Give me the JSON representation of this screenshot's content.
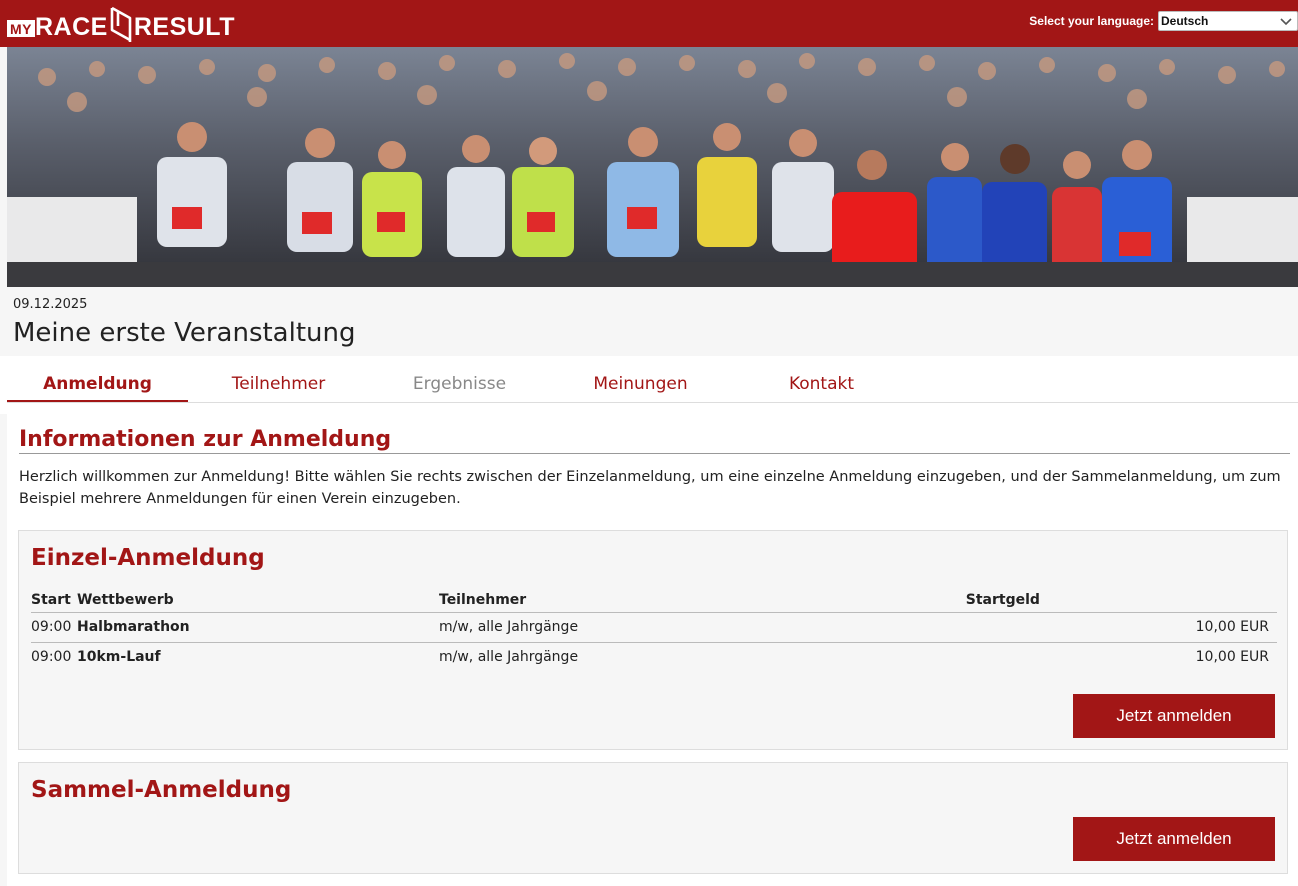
{
  "header": {
    "logo_my": "MY",
    "logo_race": "RACE",
    "logo_result": "RESULT",
    "language_label": "Select your language:",
    "language_selected": "Deutsch"
  },
  "event": {
    "date": "09.12.2025",
    "title": "Meine erste Veranstaltung"
  },
  "tabs": [
    {
      "label": "Anmeldung",
      "state": "active"
    },
    {
      "label": "Teilnehmer",
      "state": "normal"
    },
    {
      "label": "Ergebnisse",
      "state": "disabled"
    },
    {
      "label": "Meinungen",
      "state": "normal"
    },
    {
      "label": "Kontakt",
      "state": "normal"
    }
  ],
  "info": {
    "title": "Informationen zur Anmeldung",
    "text": "Herzlich willkommen zur Anmeldung! Bitte wählen Sie rechts zwischen der Einzelanmeldung, um eine einzelne Anmeldung einzugeben, und der Sammelanmeldung, um zum Beispiel mehrere Anmeldungen für einen Verein einzugeben."
  },
  "einzel": {
    "title": "Einzel-Anmeldung",
    "columns": {
      "start": "Start",
      "competition": "Wettbewerb",
      "participants": "Teilnehmer",
      "fee": "Startgeld"
    },
    "rows": [
      {
        "start": "09:00",
        "competition": "Halbmarathon",
        "participants": "m/w, alle Jahrgänge",
        "fee": "10,00 EUR"
      },
      {
        "start": "09:00",
        "competition": "10km-Lauf",
        "participants": "m/w, alle Jahrgänge",
        "fee": "10,00 EUR"
      }
    ],
    "button": "Jetzt anmelden"
  },
  "sammel": {
    "title": "Sammel-Anmeldung",
    "button": "Jetzt anmelden"
  },
  "colors": {
    "brand": "#a21616",
    "page_bg": "#f6f6f6"
  }
}
